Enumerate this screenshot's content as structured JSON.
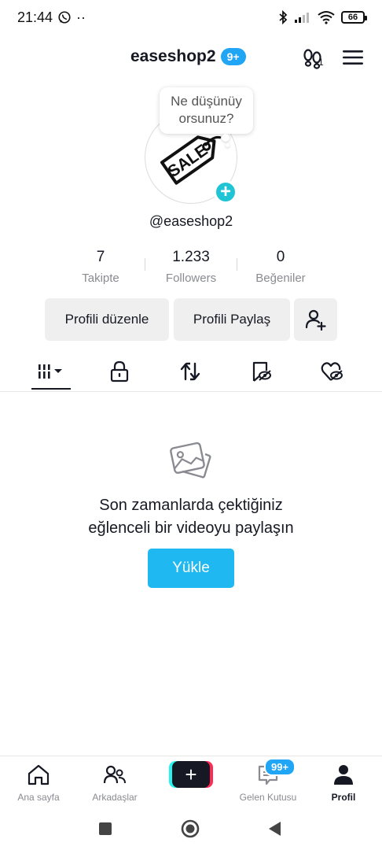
{
  "status_bar": {
    "time": "21:44",
    "battery": "66",
    "extra": "··"
  },
  "header": {
    "username": "easeshop2",
    "notification_badge": "9+",
    "footprint_count": "1"
  },
  "profile": {
    "thought_bubble": "Ne düşünüyorsunuz?",
    "handle": "@easeshop2",
    "avatar_text": "SALE",
    "stats": [
      {
        "value": "7",
        "label": "Takipte"
      },
      {
        "value": "1.233",
        "label": "Followers"
      },
      {
        "value": "0",
        "label": "Beğeniler"
      }
    ]
  },
  "actions": {
    "edit_profile": "Profili düzenle",
    "share_profile": "Profili Paylaş"
  },
  "tabs": [
    {
      "icon": "videos-grid-icon"
    },
    {
      "icon": "lock-icon"
    },
    {
      "icon": "repost-icon"
    },
    {
      "icon": "favorites-icon"
    },
    {
      "icon": "liked-icon"
    }
  ],
  "empty_state": {
    "message_line1": "Son zamanlarda çektiğiniz",
    "message_line2": "eğlenceli bir videoyu paylaşın",
    "upload_label": "Yükle"
  },
  "bottom_nav": {
    "home": "Ana sayfa",
    "friends": "Arkadaşlar",
    "inbox": "Gelen Kutusu",
    "inbox_badge": "99+",
    "profile": "Profil",
    "create_label": "+"
  },
  "colors": {
    "accent_blue": "#20b8f0",
    "badge_blue": "#21a5f5",
    "tiktok_cyan": "#25f4ee",
    "tiktok_red": "#fe2c55"
  }
}
